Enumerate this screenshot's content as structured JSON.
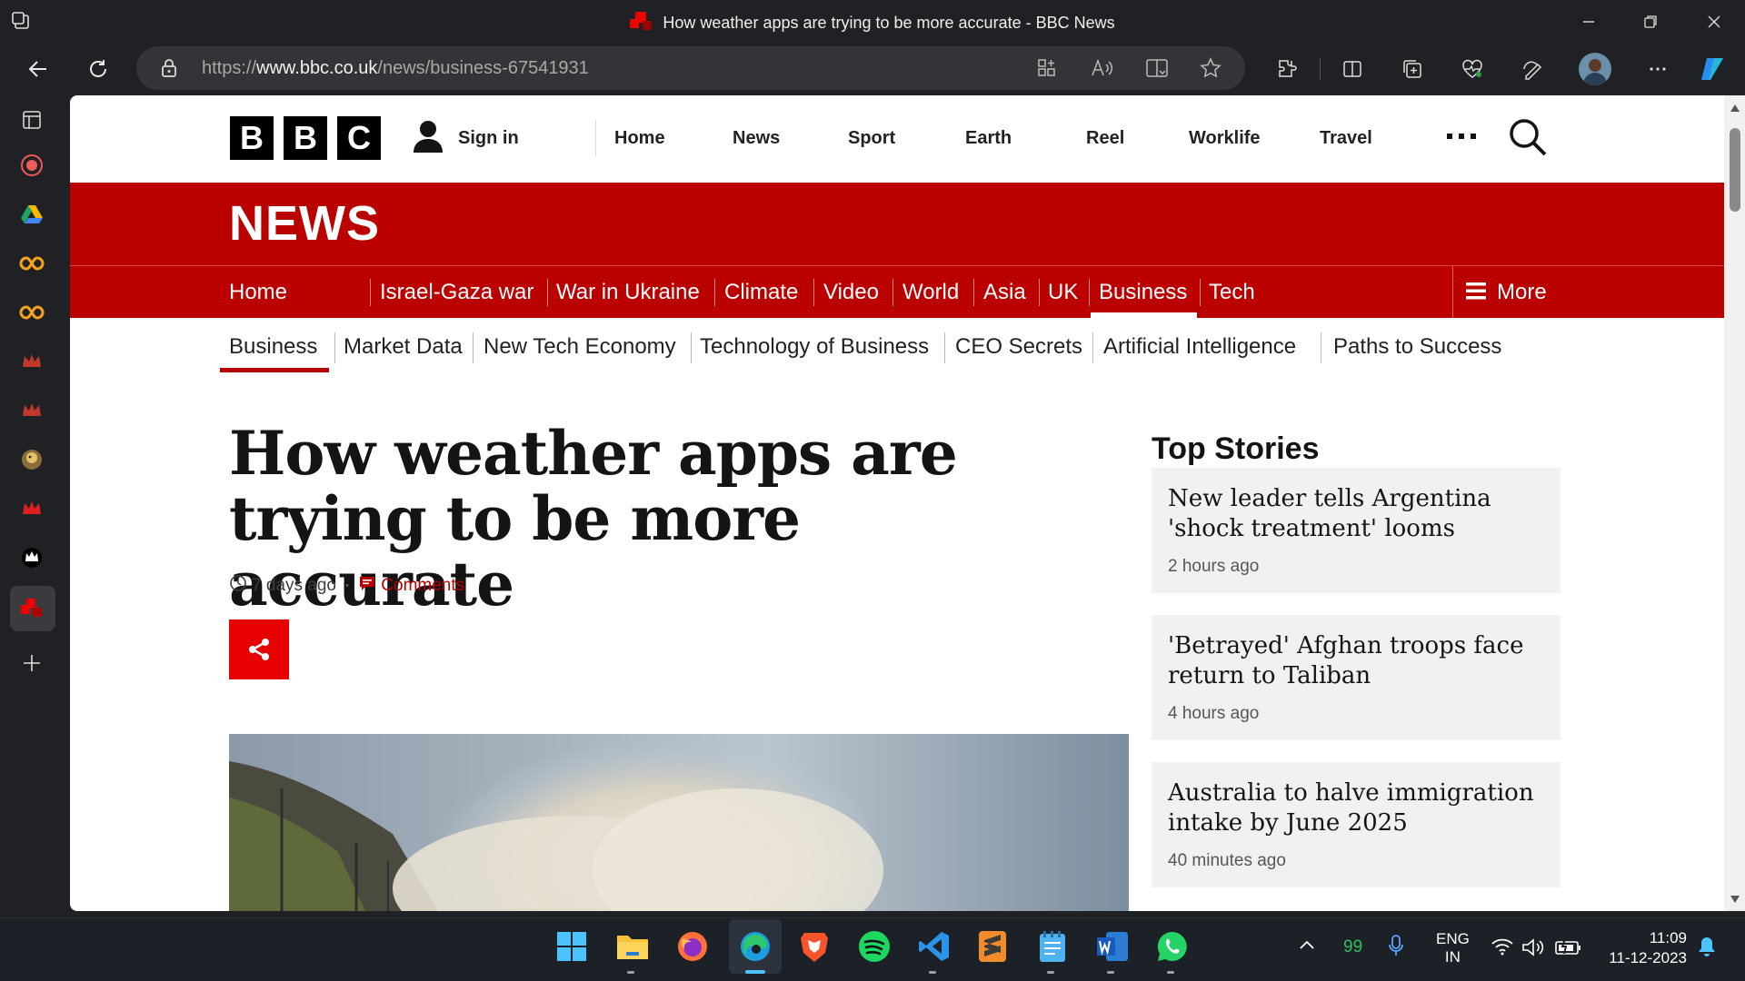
{
  "browser": {
    "window_title": "How weather apps are trying to be more accurate - BBC News",
    "url_prefix": "https://",
    "url_domain": "www.bbc.co.uk",
    "url_path": "/news/business-67541931"
  },
  "bbc_header": {
    "logo_letters": [
      "B",
      "B",
      "C"
    ],
    "sign_in": "Sign in",
    "nav": [
      "Home",
      "News",
      "Sport",
      "Earth",
      "Reel",
      "Worklife",
      "Travel"
    ]
  },
  "news_header": {
    "title": "NEWS",
    "sections": [
      "Home",
      "Israel-Gaza war",
      "War in Ukraine",
      "Climate",
      "Video",
      "World",
      "Asia",
      "UK",
      "Business",
      "Tech"
    ],
    "active_section": "Business",
    "more_label": "More",
    "subsections": [
      "Business",
      "Market Data",
      "New Tech Economy",
      "Technology of Business",
      "CEO Secrets",
      "Artificial Intelligence",
      "Paths to Success"
    ]
  },
  "article": {
    "headline": "How weather apps are trying to be more accurate",
    "time": "7 days ago",
    "comments": "Comments"
  },
  "top_stories": {
    "heading": "Top Stories",
    "items": [
      {
        "title": "New leader tells Argentina 'shock treatment' looms",
        "time": "2 hours ago"
      },
      {
        "title": "'Betrayed' Afghan troops face return to Taliban",
        "time": "4 hours ago"
      },
      {
        "title": "Australia to halve immigration intake by June 2025",
        "time": "40 minutes ago"
      }
    ]
  },
  "taskbar": {
    "badge": "99",
    "lang1": "ENG",
    "lang2": "IN",
    "time": "11:09",
    "date": "11-12-2023"
  },
  "colors": {
    "bbc_red": "#bb0000",
    "share_red": "#e60000",
    "browser_dark": "#202124"
  }
}
